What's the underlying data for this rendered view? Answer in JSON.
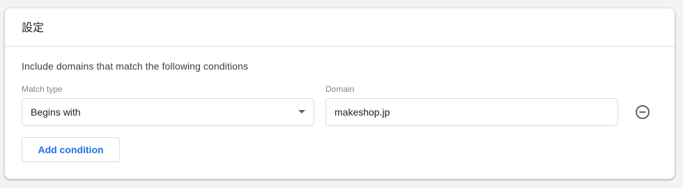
{
  "card": {
    "title": "設定"
  },
  "conditions": {
    "heading": "Include domains that match the following conditions",
    "match_type_label": "Match type",
    "domain_label": "Domain",
    "rows": [
      {
        "match_type": "Begins with",
        "domain": "makeshop.jp"
      }
    ],
    "add_label": "Add condition",
    "remove_icon": "remove-circle-outline-icon"
  },
  "colors": {
    "accent": "#1a73e8",
    "border": "#dadce0",
    "label": "#80868b",
    "background": "#f1f3f4"
  }
}
